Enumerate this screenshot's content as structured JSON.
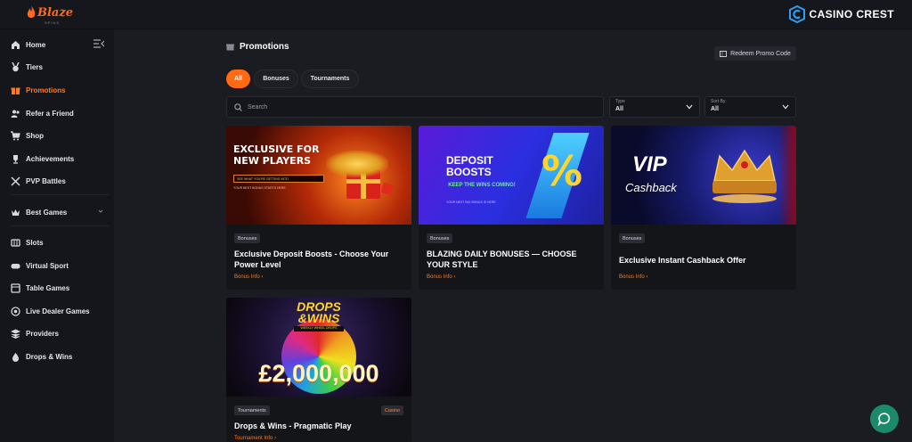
{
  "header": {
    "logo_text": "Blaze",
    "logo_sub": "SPINS",
    "brand_name": "CASINO CREST"
  },
  "sidebar": {
    "items": [
      {
        "label": "Home",
        "icon": "home-icon"
      },
      {
        "label": "Tiers",
        "icon": "medal-icon"
      },
      {
        "label": "Promotions",
        "icon": "gift-icon",
        "active": true
      },
      {
        "label": "Refer a Friend",
        "icon": "users-icon"
      },
      {
        "label": "Shop",
        "icon": "cart-icon"
      },
      {
        "label": "Achievements",
        "icon": "trophy-icon"
      },
      {
        "label": "PVP Battles",
        "icon": "swords-icon"
      },
      {
        "label": "Best Games",
        "icon": "crown-icon"
      },
      {
        "label": "Slots",
        "icon": "slots-icon"
      },
      {
        "label": "Virtual Sport",
        "icon": "gamepad-icon"
      },
      {
        "label": "Table Games",
        "icon": "table-icon"
      },
      {
        "label": "Live Dealer Games",
        "icon": "chip-icon"
      },
      {
        "label": "Providers",
        "icon": "providers-icon"
      },
      {
        "label": "Drops & Wins",
        "icon": "drops-icon"
      }
    ]
  },
  "page": {
    "title": "Promotions",
    "redeem_label": "Redeem Promo Code",
    "tabs": [
      "All",
      "Bonuses",
      "Tournaments"
    ],
    "search_placeholder": "Search",
    "type_label": "Type",
    "type_value": "All",
    "sort_label": "Sort By",
    "sort_value": "All"
  },
  "cards": [
    {
      "tag": "Bonuses",
      "title": "Exclusive Deposit Boosts - Choose Your Power Level",
      "link": "Bonus Info",
      "banner": {
        "line1": "EXCLUSIVE FOR",
        "line2": "NEW PLAYERS",
        "strip": "SEE WHAT YOU'RE GETTING INTO",
        "note": "YOUR BEST BONUS STARTS HERE"
      }
    },
    {
      "tag": "Bonuses",
      "title": "BLAZING DAILY BONUSES — CHOOSE YOUR STYLE",
      "link": "Bonus Info",
      "banner": {
        "line1": "DEPOSIT",
        "line2": "BOOSTS",
        "strip": "KEEP THE WINS COMING!",
        "note": "YOUR NEXT BIG BONUS IS HERE",
        "symbol": "%"
      }
    },
    {
      "tag": "Bonuses",
      "title": "Exclusive Instant Cashback Offer",
      "link": "Bonus Info",
      "banner": {
        "line1": "VIP",
        "line2": "Cashback"
      }
    },
    {
      "tag": "Tournaments",
      "tag2": "Casino",
      "title": "Drops & Wins - Pragmatic Play",
      "link": "Tournament Info",
      "banner": {
        "line1": "DROPS",
        "line2": "&WINS",
        "strip": "WEEKLY WHEEL DROPS",
        "amount": "£2,000,000"
      }
    }
  ]
}
